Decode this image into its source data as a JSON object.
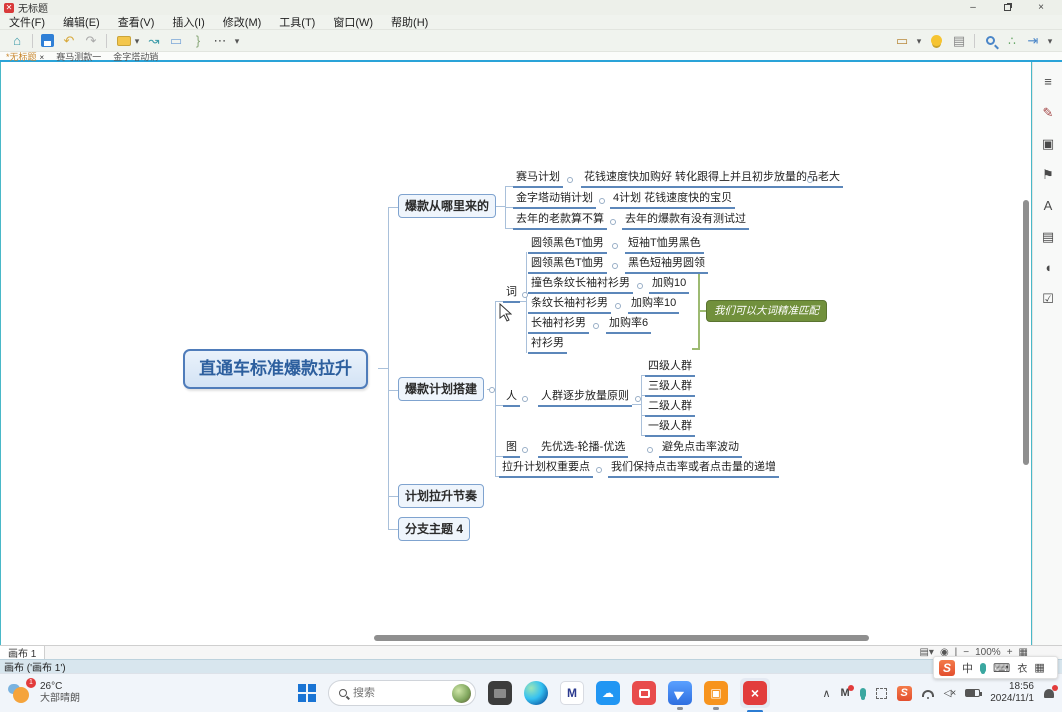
{
  "window": {
    "title": "无标题",
    "controls": {
      "minimize": "–",
      "close": "×"
    }
  },
  "menu": {
    "items": [
      "文件(F)",
      "编辑(E)",
      "查看(V)",
      "插入(I)",
      "修改(M)",
      "工具(T)",
      "窗口(W)",
      "帮助(H)"
    ]
  },
  "toolbar": {
    "left_icons": [
      "home",
      "save",
      "undo",
      "redo",
      "theme-layout",
      "dropdown",
      "relationship",
      "callout",
      "summary",
      "more",
      "dropdown"
    ],
    "right_icons": [
      "presentation",
      "dropdown",
      "idea-tips",
      "panel",
      "zoom-search",
      "share",
      "export",
      "dropdown"
    ],
    "glyphs": {
      "home": "⌂",
      "undo": "↶",
      "redo": "↷",
      "dropdown": "▾",
      "relationship": "↝",
      "callout": "▭",
      "summary": "}",
      "more": "⋯",
      "present": "▭",
      "panel": "▤",
      "export": "⇥"
    }
  },
  "doc_tabs": {
    "active": "*无标题",
    "close": "×",
    "others": [
      "赛马测款一",
      "金字塔动销"
    ]
  },
  "mindmap": {
    "root": "直通车标准爆款拉升",
    "branches": [
      {
        "label": "爆款从哪里来的",
        "rows": [
          [
            "赛马计划",
            "花钱速度快加购好 转化跟得上并且初步放量的品",
            "老大"
          ],
          [
            "金字塔动销计划",
            "4计划 花钱速度快的宝贝"
          ],
          [
            "去年的老款算不算",
            "去年的爆款有没有测试过"
          ]
        ]
      },
      {
        "label": "爆款计划搭建",
        "word": {
          "label": "词",
          "rows": [
            [
              "圆领黑色T恤男",
              "短袖T恤男黑色"
            ],
            [
              "圆领黑色T恤男",
              "黑色短袖男圆领"
            ],
            [
              "撞色条纹长袖衬衫男",
              "加购10"
            ],
            [
              "条纹长袖衬衫男",
              "加购率10"
            ],
            [
              "长袖衬衫男",
              "加购率6"
            ],
            [
              "衬衫男"
            ]
          ],
          "summary": "我们可以大词精准匹配"
        },
        "people": {
          "label": "人",
          "principle": "人群逐步放量原则",
          "groups": [
            "四级人群",
            "三级人群",
            "二级人群",
            "一级人群"
          ]
        },
        "image": {
          "label": "图",
          "step": "先优选-轮播-优选",
          "note": "避免点击率波动"
        },
        "weight": {
          "label": "拉升计划权重要点",
          "note": "我们保持点击率或者点击量的递增"
        }
      },
      {
        "label": "计划拉升节奏"
      },
      {
        "label": "分支主题 4"
      }
    ]
  },
  "sidebar": {
    "icons": [
      "outline",
      "style-brush",
      "image",
      "flag",
      "text",
      "note",
      "comment",
      "task"
    ]
  },
  "canvas_bar": {
    "tab": "画布 1",
    "zoom_out": "−",
    "zoom_level": "100%",
    "zoom_in": "+"
  },
  "status_bar": {
    "text": "画布 ('画布 1')"
  },
  "ime": {
    "mode": "中",
    "icons": [
      "sogou-logo",
      "chinese-mode",
      "voice",
      "keyboard",
      "skin",
      "toolbox"
    ]
  },
  "taskbar": {
    "weather": {
      "badge": "1",
      "temp": "26°C",
      "desc": "大部晴朗"
    },
    "search": {
      "placeholder": "搜索"
    },
    "apps": [
      "file-explorer",
      "edge",
      "mindmaster",
      "cloud-drive",
      "red-app",
      "pointer-app",
      "camera-app",
      "mindmap-app-active"
    ],
    "tray": {
      "chevron": "∧",
      "time": "18:56",
      "date": "2024/11/1",
      "badge": "1"
    }
  }
}
